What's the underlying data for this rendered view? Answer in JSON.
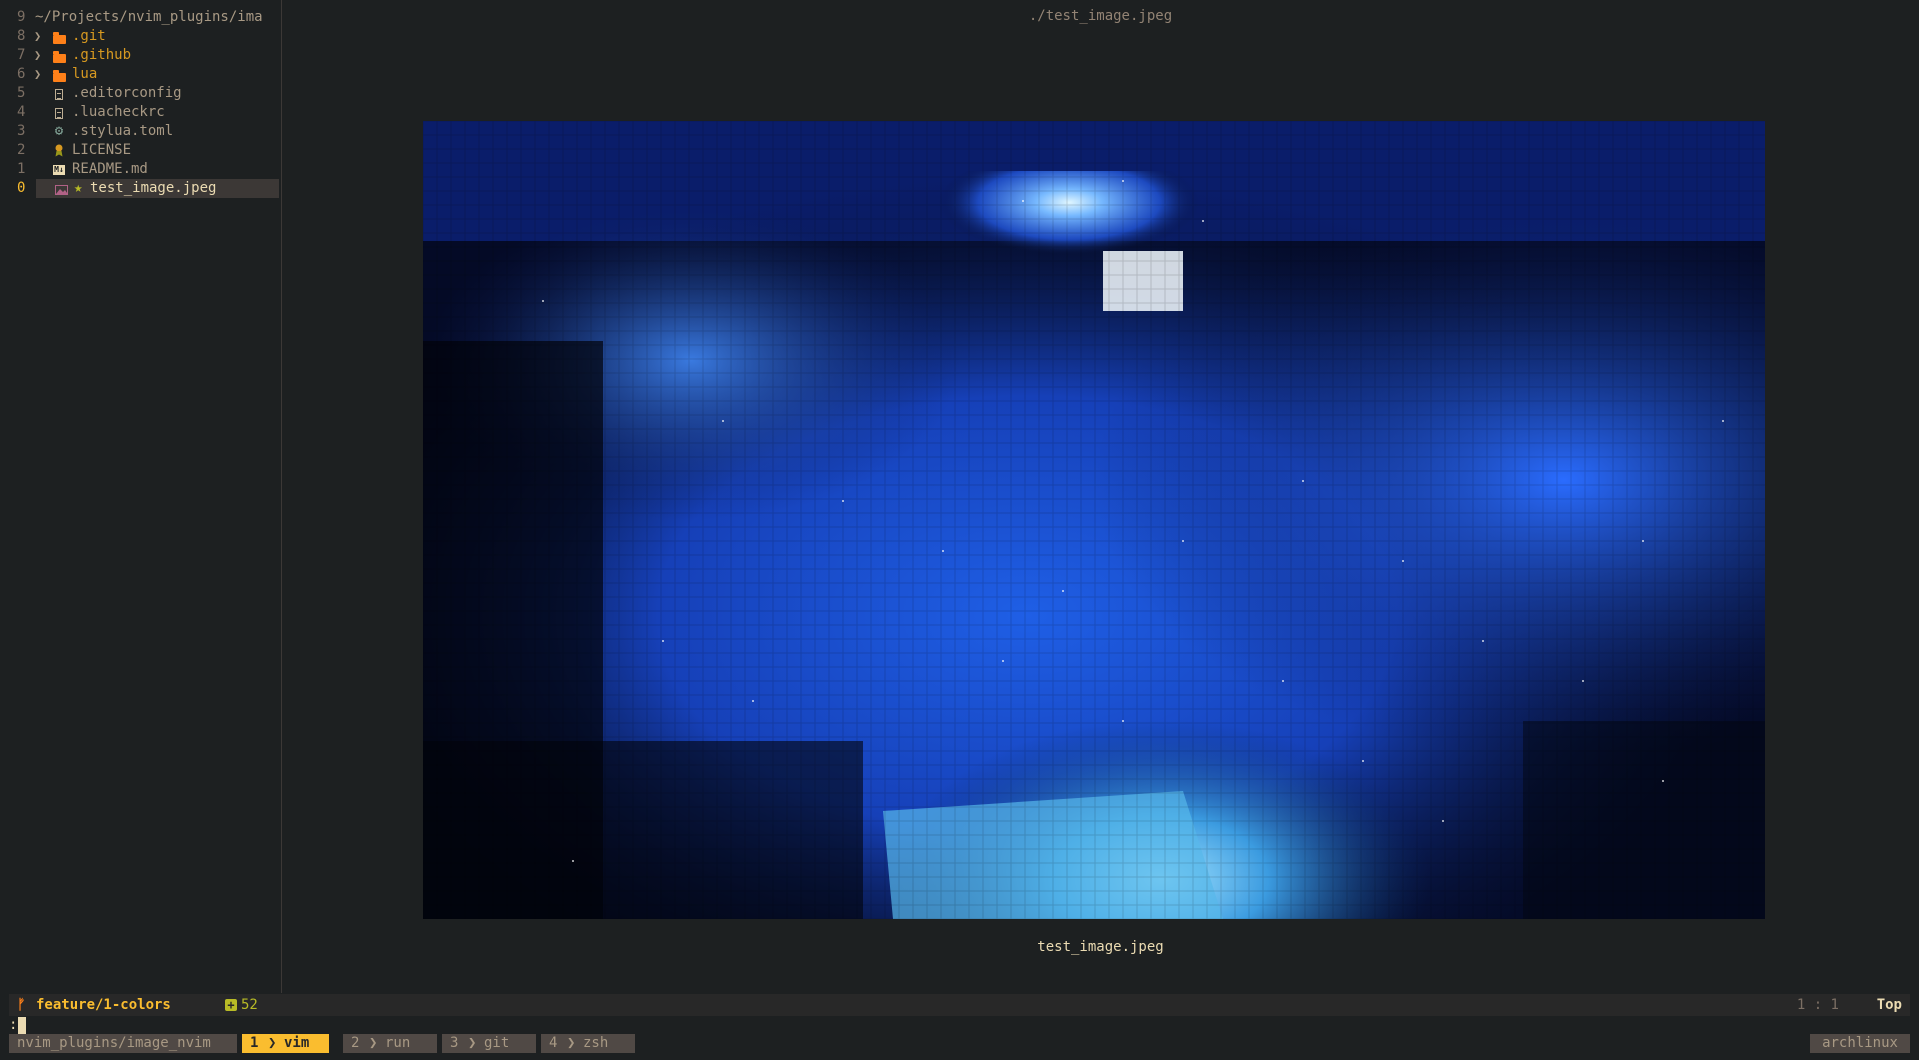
{
  "explorer": {
    "header": {
      "line_number": "9",
      "path": "~/Projects/nvim_plugins/ima"
    },
    "items": [
      {
        "line_number": "8",
        "name": ".git",
        "type": "folder",
        "icon": "folder-icon"
      },
      {
        "line_number": "7",
        "name": ".github",
        "type": "folder",
        "icon": "folder-icon"
      },
      {
        "line_number": "6",
        "name": "lua",
        "type": "folder",
        "icon": "folder-icon"
      },
      {
        "line_number": "5",
        "name": ".editorconfig",
        "type": "file",
        "icon": "file-icon"
      },
      {
        "line_number": "4",
        "name": ".luacheckrc",
        "type": "file",
        "icon": "file-icon"
      },
      {
        "line_number": "3",
        "name": ".stylua.toml",
        "type": "file",
        "icon": "gear-icon"
      },
      {
        "line_number": "2",
        "name": "LICENSE",
        "type": "file",
        "icon": "license-icon"
      },
      {
        "line_number": "1",
        "name": "README.md",
        "type": "file",
        "icon": "markdown-icon"
      },
      {
        "line_number": "0",
        "name": "test_image.jpeg",
        "type": "file",
        "icon": "image-icon",
        "selected": true,
        "marker": "★"
      }
    ]
  },
  "main": {
    "file_title": "./test_image.jpeg",
    "caption": "test_image.jpeg"
  },
  "statusline": {
    "branch_icon": "ᚠ",
    "branch": "feature/1-colors",
    "diff_icon": "+",
    "diff_count": "52",
    "position": "1 : 1",
    "scroll": "Top"
  },
  "cmdline": {
    "text": ":"
  },
  "tmux": {
    "session": "nvim_plugins/image_nvim",
    "windows": [
      {
        "num": "1",
        "name": "vim",
        "active": true
      },
      {
        "num": "2",
        "name": "run",
        "active": false
      },
      {
        "num": "3",
        "name": "git",
        "active": false
      },
      {
        "num": "4",
        "name": "zsh",
        "active": false
      }
    ],
    "host": "archlinux"
  },
  "colors": {
    "background": "#1d2021",
    "accent": "#fabd2f",
    "folder": "#fe8019",
    "diff_added": "#b8bb26"
  }
}
